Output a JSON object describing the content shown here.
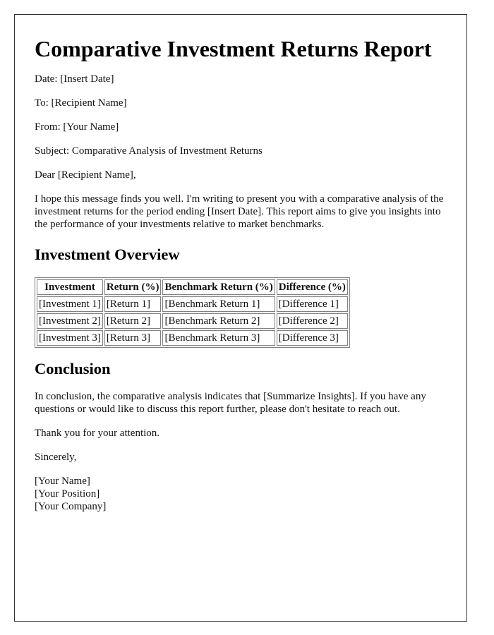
{
  "document": {
    "title": "Comparative Investment Returns Report",
    "meta": {
      "date": "Date: [Insert Date]",
      "to": "To: [Recipient Name]",
      "from": "From: [Your Name]",
      "subject": "Subject: Comparative Analysis of Investment Returns"
    },
    "salutation": "Dear [Recipient Name],",
    "intro": "I hope this message finds you well. I'm writing to present you with a comparative analysis of the investment returns for the period ending [Insert Date]. This report aims to give you insights into the performance of your investments relative to market benchmarks.",
    "overview": {
      "heading": "Investment Overview",
      "columns": [
        "Investment",
        "Return (%)",
        "Benchmark Return (%)",
        "Difference (%)"
      ],
      "rows": [
        [
          "[Investment 1]",
          "[Return 1]",
          "[Benchmark Return 1]",
          "[Difference 1]"
        ],
        [
          "[Investment 2]",
          "[Return 2]",
          "[Benchmark Return 2]",
          "[Difference 2]"
        ],
        [
          "[Investment 3]",
          "[Return 3]",
          "[Benchmark Return 3]",
          "[Difference 3]"
        ]
      ]
    },
    "conclusion": {
      "heading": "Conclusion",
      "body": "In conclusion, the comparative analysis indicates that [Summarize Insights]. If you have any questions or would like to discuss this report further, please don't hesitate to reach out.",
      "thanks": "Thank you for your attention.",
      "closing": "Sincerely,"
    },
    "signature": {
      "name": "[Your Name]",
      "position": "[Your Position]",
      "company": "[Your Company]"
    }
  }
}
